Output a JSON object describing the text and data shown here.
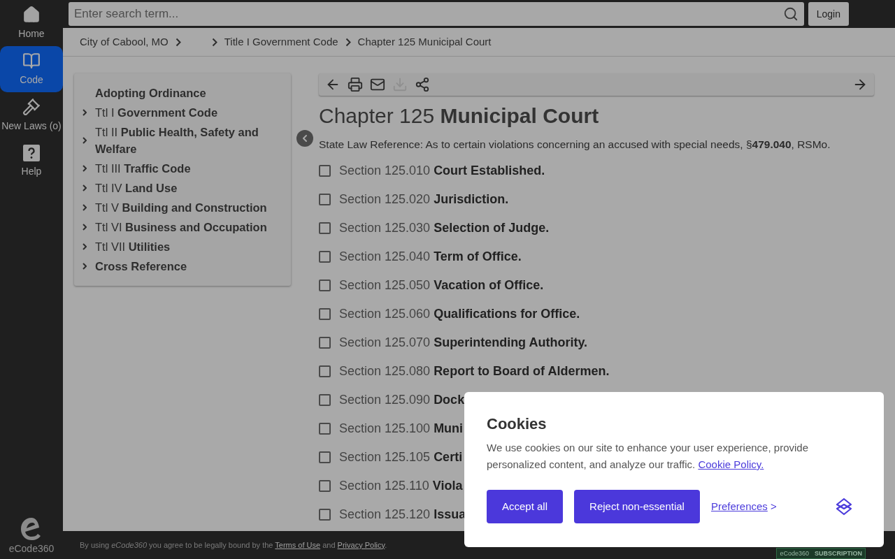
{
  "nav": [
    {
      "label": "Home",
      "kind": "home",
      "selected": false
    },
    {
      "label": "Code",
      "kind": "code",
      "selected": true
    },
    {
      "label": "New Laws (o)",
      "kind": "laws",
      "selected": false
    },
    {
      "label": "Help",
      "kind": "help",
      "selected": false
    }
  ],
  "logo": {
    "text": "eCode360"
  },
  "search": {
    "placeholder": "Enter search term..."
  },
  "login": "Login",
  "breadcrumbs": [
    {
      "text": "City of Cabool, MO",
      "trailing_separator": true
    },
    {
      "text": "Title I Government Code",
      "trailing_separator": false
    },
    {
      "text": "Chapter 125 Municipal Court",
      "trailing_separator": false
    }
  ],
  "toc": [
    {
      "title": "Adopting Ordinance",
      "expandable": false
    },
    {
      "prefix": "Ttl I",
      "title": "Government Code",
      "expandable": true
    },
    {
      "prefix": "Ttl II",
      "title": "Public Health, Safety and Welfare",
      "expandable": true
    },
    {
      "prefix": "Ttl III",
      "title": "Traffic Code",
      "expandable": true
    },
    {
      "prefix": "Ttl IV",
      "title": "Land Use",
      "expandable": true
    },
    {
      "prefix": "Ttl V",
      "title": "Building and Construction",
      "expandable": true
    },
    {
      "prefix": "Ttl VI",
      "title": "Business and Occupation",
      "expandable": true
    },
    {
      "prefix": "Ttl VII",
      "title": "Utilities",
      "expandable": true
    },
    {
      "title": "Cross Reference",
      "expandable": true
    }
  ],
  "toolbar": [
    {
      "kind": "back",
      "disabled": false
    },
    {
      "kind": "print",
      "disabled": false
    },
    {
      "kind": "email",
      "disabled": false
    },
    {
      "kind": "download",
      "disabled": true
    },
    {
      "kind": "share",
      "disabled": false
    },
    {
      "kind": "forward",
      "disabled": false
    }
  ],
  "chapter": {
    "number": "Chapter 125",
    "title": "Municipal Court"
  },
  "reference": "State Law Reference: As to certain violations concerning an accused with special needs, §**479.040**, RSMo.",
  "sections": [
    {
      "number": "Section 125.010",
      "title": "Court Established.",
      "checked": false
    },
    {
      "number": "Section 125.020",
      "title": "Jurisdiction.",
      "checked": false
    },
    {
      "number": "Section 125.030",
      "title": "Selection of Judge.",
      "checked": false
    },
    {
      "number": "Section 125.040",
      "title": "Term of Office.",
      "checked": false
    },
    {
      "number": "Section 125.050",
      "title": "Vacation of Office.",
      "checked": false
    },
    {
      "number": "Section 125.060",
      "title": "Qualifications for Office.",
      "checked": false
    },
    {
      "number": "Section 125.070",
      "title": "Superintending Authority.",
      "checked": false
    },
    {
      "number": "Section 125.080",
      "title": "Report to Board of Aldermen.",
      "checked": false
    },
    {
      "number": "Section 125.090",
      "title": "Dock",
      "checked": false
    },
    {
      "number": "Section 125.100",
      "title": "Muni",
      "checked": false
    },
    {
      "number": "Section 125.105",
      "title": "Certi",
      "checked": false
    },
    {
      "number": "Section 125.110",
      "title": "Viola",
      "checked": false
    },
    {
      "number": "Section 125.120",
      "title": "Issua",
      "checked": false
    }
  ],
  "footer": {
    "before": "By using *eCode360* you agree to be legally bound by the ",
    "terms": "Terms of Use",
    "middle": " and ",
    "privacy": "Privacy Policy",
    "after": ".",
    "badge_logo": "eCode360",
    "badge_text": "SUBSCRIPTION"
  },
  "cookies": {
    "title": "Cookies",
    "text": "We use cookies on our site to enhance your user experience, provide personalized content, and analyze our traffic.",
    "policy": "Cookie Policy.",
    "accept": "Accept all",
    "reject": "Reject non-essential",
    "preferences": "Preferences",
    "preferences_arrow": ">"
  }
}
